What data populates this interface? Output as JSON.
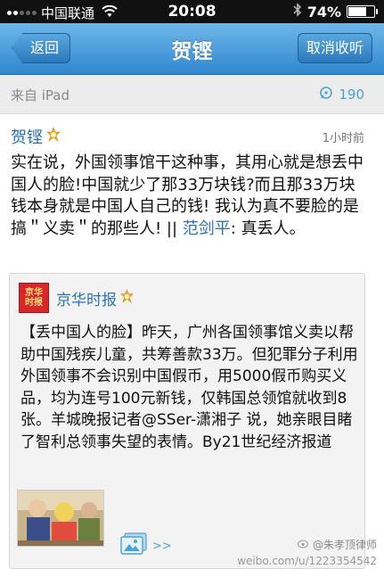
{
  "status_bar": {
    "carrier": "中国联通",
    "time": "20:08",
    "battery_percent": "74%",
    "battery_level": 0.74
  },
  "nav": {
    "back_label": "返回",
    "title": "贺铿",
    "action_label": "取消收听"
  },
  "source_bar": {
    "source_text": "来自 iPad",
    "comment_count": "190"
  },
  "post": {
    "author": "贺铿",
    "time": "1小时前",
    "body_text": "实在说，外国领事馆干这种事，其用心就是想丢中国人的脸!中国就少了那33万块钱?而且那33万块钱本身就是中国人自己的钱! 我认为真不要脸的是搞＂义卖＂的那些人! || ",
    "mention": "范剑平",
    "mention_text": ": 真丢人。"
  },
  "quoted_post": {
    "logo_line1": "京华",
    "logo_line2": "时报",
    "author": "京华时报",
    "body_text": "【丢中国人的脸】昨天，广州各国领事馆义卖以帮助中国残疾儿童，共筹善款33万。但犯罪分子利用外国领事不会识别中国假币，用5000假币购买义品，均为连号100元新钱，仅韩国总领馆就收到8张。羊城晚报记者@SSer-潇湘子 说，她亲眼目睹了智利总领事失望的表情。By21世纪经济报道",
    "gallery_label": ">>"
  },
  "watermark": {
    "handle": "@朱孝顶律师",
    "url": "weibo.com/u/1223354542"
  },
  "colors": {
    "nav_gradient_top": "#6fb7e9",
    "nav_gradient_bottom": "#2f87cf",
    "link_blue": "#2b73b4",
    "count_blue": "#4aa3d8",
    "logo_red": "#d8262a"
  }
}
